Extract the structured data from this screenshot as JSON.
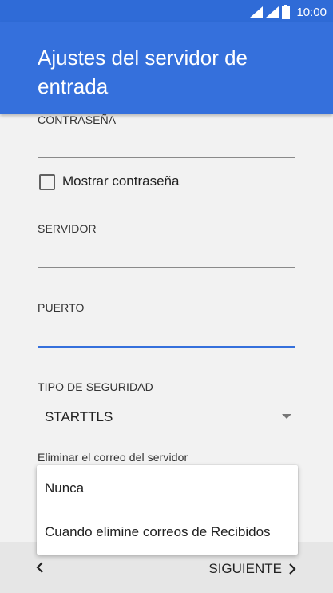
{
  "status_bar": {
    "time": "10:00",
    "icons": [
      "signal-icon",
      "signal-icon",
      "battery-icon"
    ]
  },
  "header": {
    "title": "Ajustes del servidor de entrada"
  },
  "form": {
    "password_label": "CONTRASEÑA",
    "password_value": "",
    "show_password_label": "Mostrar contraseña",
    "show_password_checked": false,
    "server_label": "SERVIDOR",
    "server_value": "",
    "port_label": "PUERTO",
    "port_value": "",
    "security_label": "TIPO DE SEGURIDAD",
    "security_value": "STARTTLS",
    "delete_label": "Eliminar el correo del servidor"
  },
  "dropdown": {
    "options": [
      "Nunca",
      "Cuando elimine correos de Recibidos"
    ]
  },
  "footer": {
    "back_icon": "chevron-left-icon",
    "next_label": "SIGUIENTE",
    "next_icon": "chevron-right-icon"
  },
  "colors": {
    "accent": "#3570dc",
    "status_bar": "#2f6bd7",
    "background": "#f2f2f2"
  }
}
